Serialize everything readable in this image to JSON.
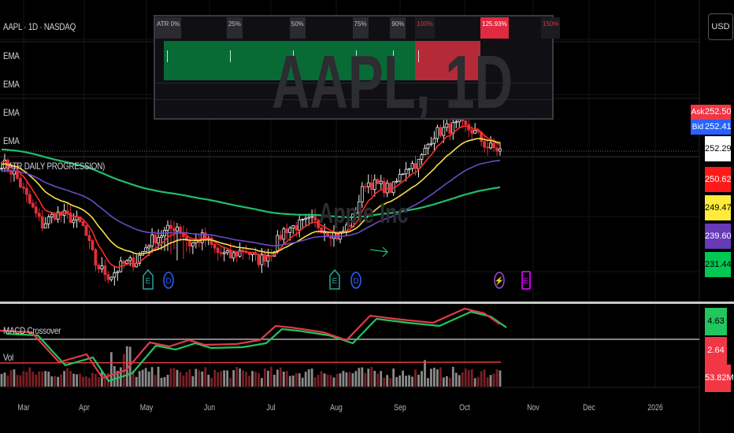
{
  "header": {
    "symbol": "AAPL · 1D · NASDAQ",
    "currency": "USD"
  },
  "legends": {
    "ema": [
      "EMA",
      "EMA",
      "EMA",
      "EMA"
    ],
    "atr_progression": "ATR DAILY PROGRESSION)",
    "macd": "MACD Crossover",
    "vol": "Vol"
  },
  "watermark": {
    "title": "AAPL, 1D",
    "subtitle": "Apple Inc"
  },
  "atr_panel": {
    "labels": [
      {
        "text": "ATR 0%",
        "type": "normal"
      },
      {
        "text": "25%",
        "type": "normal"
      },
      {
        "text": "50%",
        "type": "normal"
      },
      {
        "text": "75%",
        "type": "normal"
      },
      {
        "text": "90%",
        "type": "normal"
      },
      {
        "text": "100%",
        "type": "red"
      },
      {
        "text": "125.93%",
        "type": "highlight"
      },
      {
        "text": "150%",
        "type": "red"
      }
    ],
    "progress_percent": 125.93,
    "scale_max_percent": 150,
    "colors": {
      "green": "#086b36",
      "red": "#b62a38"
    }
  },
  "price_axis": {
    "ask": {
      "tag": "Ask",
      "value": "252.50",
      "color": "#f23645"
    },
    "bid": {
      "tag": "Bid",
      "value": "252.41",
      "color": "#2962ff"
    },
    "labels": [
      {
        "value": "252.29",
        "bg": "#ffffff",
        "fg": "#000000"
      },
      {
        "value": "250.62",
        "bg": "#ff1a1a",
        "fg": "#ffffff"
      },
      {
        "value": "249.47",
        "bg": "#ffeb3b",
        "fg": "#000000"
      },
      {
        "value": "239.60",
        "bg": "#673ab7",
        "fg": "#ffffff"
      },
      {
        "value": "231.44",
        "bg": "#00c853",
        "fg": "#000000"
      }
    ]
  },
  "lower_axis": [
    {
      "value": "4.63",
      "bg": "#22c55e",
      "fg": "#000000"
    },
    {
      "value": "2.64",
      "bg": "#f23645",
      "fg": "#ffffff"
    },
    {
      "value": "53.82M",
      "bg": "#f23645",
      "fg": "#ffffff"
    }
  ],
  "x_axis": [
    "Mar",
    "Apr",
    "May",
    "Jun",
    "Jul",
    "Aug",
    "Sep",
    "Oct",
    "Nov",
    "Dec",
    "2026"
  ],
  "events": [
    {
      "letter": "E",
      "color": "#26a69a",
      "kind": "earnings"
    },
    {
      "letter": "D",
      "color": "#2962ff",
      "kind": "dividend"
    },
    {
      "letter": "E",
      "color": "#26a69a",
      "kind": "earnings"
    },
    {
      "letter": "D",
      "color": "#2962ff",
      "kind": "dividend"
    },
    {
      "letter": "⚡",
      "color": "#9c4dcc",
      "kind": "split-or-news"
    },
    {
      "letter": "E",
      "color": "#d500f9",
      "kind": "upcoming-earnings"
    }
  ],
  "chart_data": {
    "type": "candlestick",
    "close_keypoints": [
      250.1,
      247.9,
      242.9,
      238.5,
      240.7,
      240.0,
      238.5,
      231.3,
      229.1,
      231.3,
      232.0,
      235.6,
      237.1,
      238.5,
      234.9,
      236.4,
      233.5,
      232.7,
      234.2,
      232.0,
      233.5,
      237.8,
      238.5,
      239.3,
      237.8,
      236.4,
      239.3,
      246.5,
      245.8,
      245.1,
      249.4,
      250.1,
      255.2,
      256.3,
      256.9,
      255.9,
      253.0,
      252.3
    ],
    "ema_colors": [
      "#ff2a2a",
      "#f5e04a",
      "#6b4bc4",
      "#1fbf6a"
    ]
  }
}
